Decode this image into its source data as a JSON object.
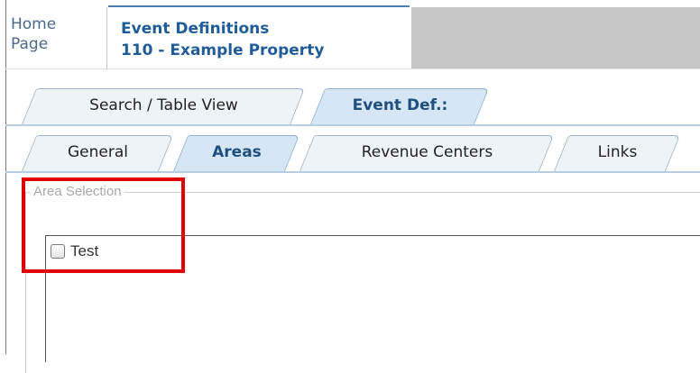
{
  "header": {
    "home_line1": "Home",
    "home_line2": "Page",
    "active_title": "Event Definitions",
    "active_subtitle": "110 - Example Property"
  },
  "tabs_main": [
    {
      "label": "Search / Table View",
      "active": false
    },
    {
      "label": "Event Def.:",
      "active": true
    }
  ],
  "tabs_sub": [
    {
      "label": "General",
      "active": false
    },
    {
      "label": "Areas",
      "active": true
    },
    {
      "label": "Revenue Centers",
      "active": false
    },
    {
      "label": "Links",
      "active": false
    }
  ],
  "area_selection": {
    "legend": "Area Selection",
    "items": [
      {
        "label": "Test",
        "checked": false
      }
    ]
  },
  "colors": {
    "header_title": "#1f5c99",
    "active_tab_bg": "#d7e6f4",
    "highlight_box": "#e00000"
  }
}
